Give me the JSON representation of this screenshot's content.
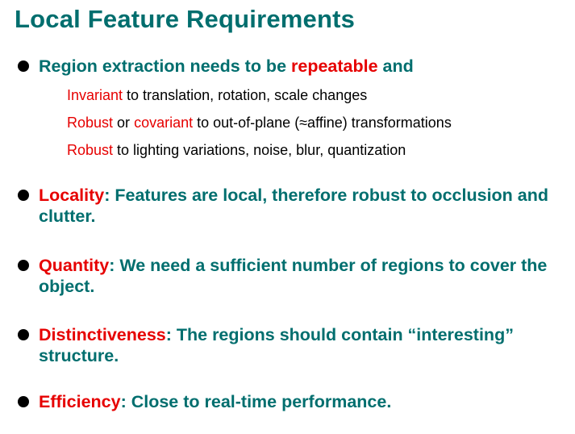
{
  "title": "Local Feature Requirements",
  "bullets": [
    {
      "highlight_prefix": "",
      "text_before": "Region extraction needs to be ",
      "highlight_mid": "repeatable",
      "text_after": " and",
      "sub": [
        {
          "red": "Invariant",
          "rest": " to translation, rotation, scale changes"
        },
        {
          "red": "Robust",
          "mid": " or ",
          "red2": "covariant",
          "rest": " to out-of-plane (≈affine) transformations"
        },
        {
          "red": "Robust",
          "rest": " to lighting variations, noise, blur, quantization"
        }
      ]
    },
    {
      "highlight": "Locality",
      "rest": ": Features are local, therefore robust to occlusion and clutter."
    },
    {
      "highlight": "Quantity",
      "rest": ": We need a sufficient number of regions to cover the object."
    },
    {
      "highlight": "Distinctiveness",
      "rest": ": The regions should contain “interesting” structure."
    },
    {
      "highlight": "Efficiency",
      "rest": ": Close to real-time performance."
    }
  ],
  "colors": {
    "teal": "#006e6e",
    "red": "#e60000",
    "bullet": "#000000"
  }
}
